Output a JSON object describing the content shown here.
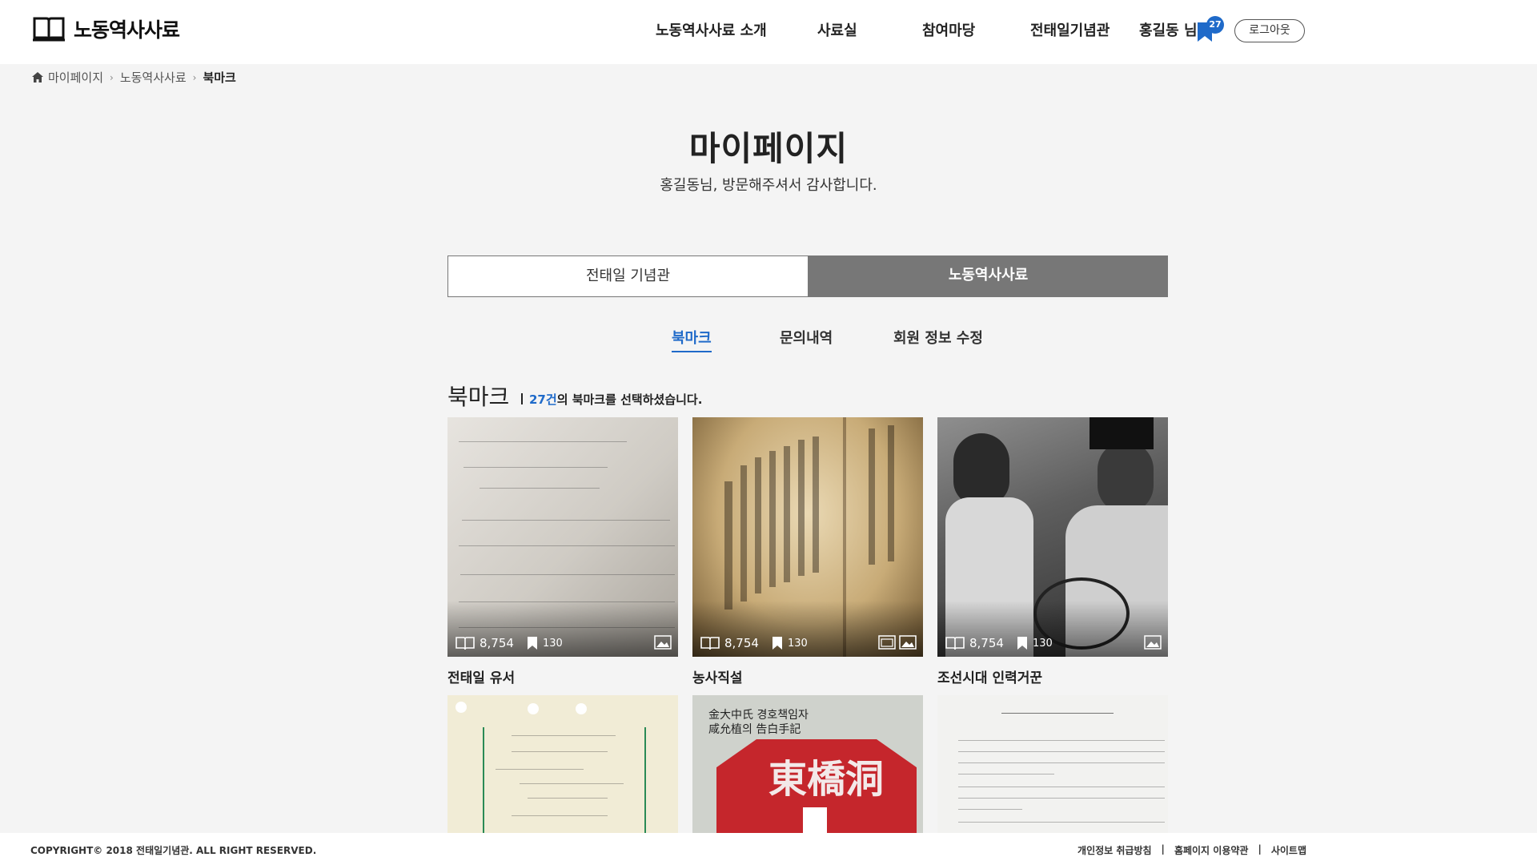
{
  "header": {
    "logo_text": "노동역사사료",
    "nav": [
      "노동역사사료 소개",
      "사료실",
      "참여마당",
      "전태일기념관"
    ],
    "user_name": "홍길동 님",
    "bookmark_count": "27",
    "logout_label": "로그아웃"
  },
  "breadcrumb": {
    "items": [
      "마이페이지",
      "노동역사사료",
      "북마크"
    ]
  },
  "page": {
    "title": "마이페이지",
    "subtitle": "홍길동님, 방문해주셔서 감사합니다."
  },
  "main_tabs": [
    {
      "label": "전태일 기념관",
      "active": false
    },
    {
      "label": "노동역사사료",
      "active": true
    }
  ],
  "sub_tabs": [
    {
      "label": "북마크",
      "active": true
    },
    {
      "label": "문의내역",
      "active": false
    },
    {
      "label": "회원 정보 수정",
      "active": false
    }
  ],
  "section": {
    "title": "북마크",
    "count": "27건",
    "desc_suffix": "의 북마크를 선택하셨습니다."
  },
  "cards": [
    {
      "title": "전태일 유서",
      "views": "8,754",
      "bookmarks": "130",
      "icons": [
        "image-icon"
      ]
    },
    {
      "title": "농사직설",
      "views": "8,754",
      "bookmarks": "130",
      "icons": [
        "document-icon",
        "image-icon"
      ]
    },
    {
      "title": "조선시대 인력거꾼",
      "views": "8,754",
      "bookmarks": "130",
      "icons": [
        "image-icon"
      ]
    },
    {
      "title": "",
      "views": "",
      "bookmarks": "",
      "icons": []
    },
    {
      "title": "",
      "views": "",
      "bookmarks": "",
      "icons": [],
      "image_text": [
        "金大中氏 경호책임자",
        "咸允植의 告白手記",
        "東橋洞"
      ]
    },
    {
      "title": "",
      "views": "",
      "bookmarks": "",
      "icons": []
    }
  ],
  "footer": {
    "copyright": "COPYRIGHT© 2018 전태일기념관. ALL RIGHT RESERVED.",
    "links": [
      "개인정보 취급방침",
      "홈페이지 이용약관",
      "사이트맵"
    ]
  },
  "colors": {
    "accent": "#1f6ac9",
    "tab_active_bg": "#777777",
    "page_bg": "#f4f4f4"
  }
}
